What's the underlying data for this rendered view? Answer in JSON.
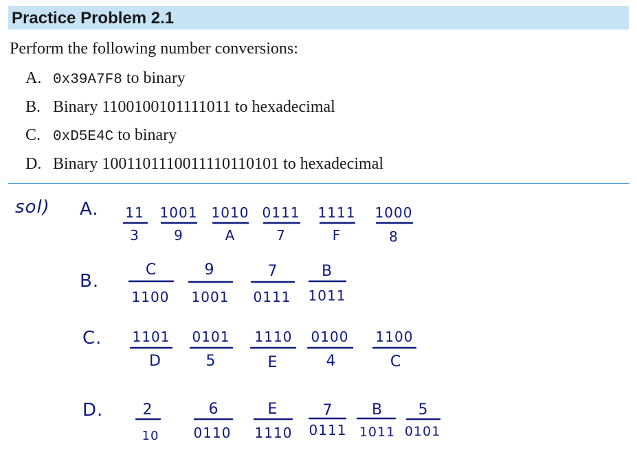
{
  "problem": {
    "title": "Practice Problem 2.1",
    "intro": "Perform the following number conversions:",
    "items": [
      {
        "letter": "A.",
        "code": "0x39A7F8",
        "rest": " to binary"
      },
      {
        "letter": "B.",
        "text": "Binary 1100100101111011 to hexadecimal"
      },
      {
        "letter": "C.",
        "code": "0xD5E4C",
        "rest": " to binary"
      },
      {
        "letter": "D.",
        "text": "Binary 1001101110011110110101 to hexadecimal"
      }
    ]
  },
  "solution": {
    "label": "sol)",
    "A": {
      "marker": "A.",
      "binary": [
        "11",
        "1001",
        "1010",
        "0111",
        "1111",
        "1000"
      ],
      "hex": [
        "3",
        "9",
        "A",
        "7",
        "F",
        "8"
      ]
    },
    "B": {
      "marker": "B.",
      "hex": [
        "C",
        "9",
        "7",
        "B"
      ],
      "binary": [
        "1100",
        "1001",
        "0111",
        "1011"
      ]
    },
    "C": {
      "marker": "C.",
      "binary": [
        "1101",
        "0101",
        "1110",
        "0100",
        "1100"
      ],
      "hex": [
        "D",
        "5",
        "E",
        "4",
        "C"
      ]
    },
    "D": {
      "marker": "D.",
      "hex": [
        "2",
        "6",
        "E",
        "7",
        "B",
        "5"
      ],
      "binary": [
        "10",
        "0110",
        "1110",
        "0111",
        "1011",
        "0101"
      ]
    }
  }
}
